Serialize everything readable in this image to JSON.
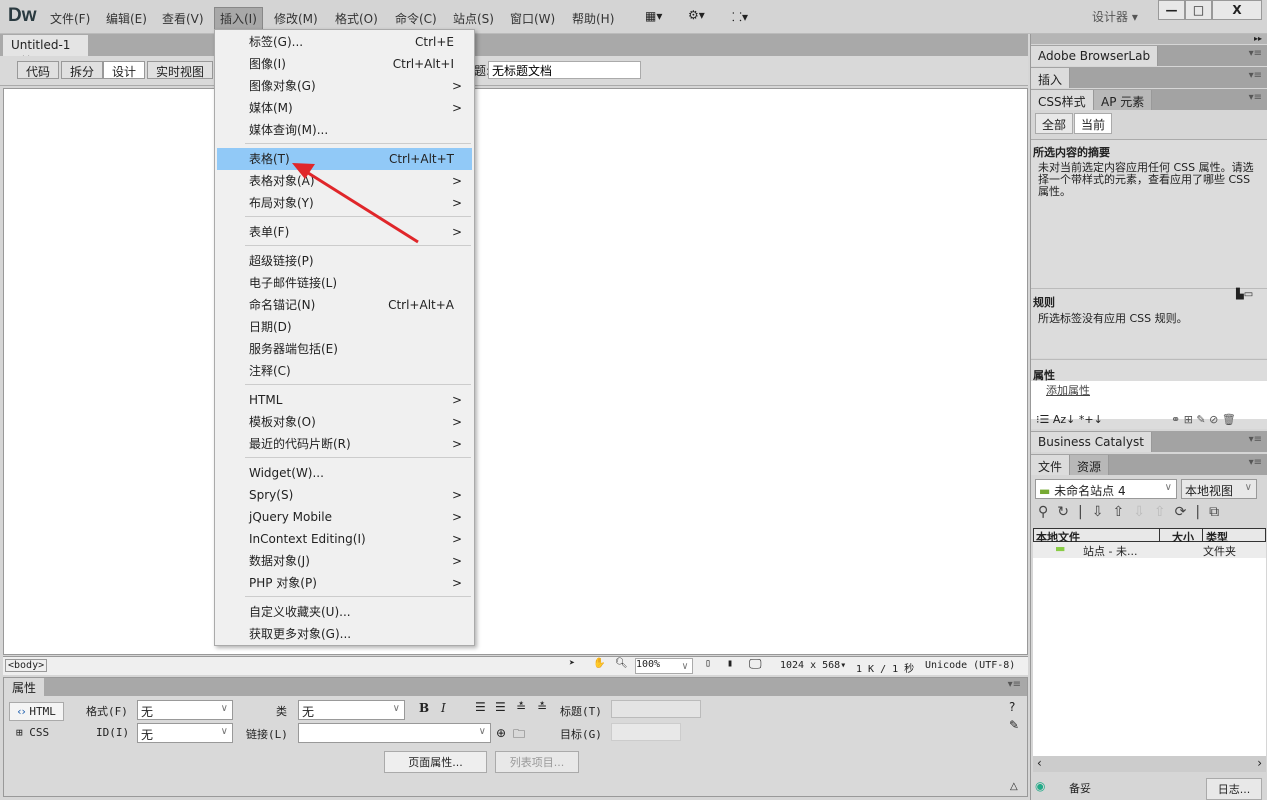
{
  "app": {
    "logo": "Dw",
    "menus": [
      "文件(F)",
      "编辑(E)",
      "查看(V)",
      "插入(I)",
      "修改(M)",
      "格式(O)",
      "命令(C)",
      "站点(S)",
      "窗口(W)",
      "帮助(H)"
    ],
    "workspace": "设计器",
    "minimize": "—",
    "maximize": "□",
    "close": "X"
  },
  "document": {
    "tab": "Untitled-1",
    "tab_close": "×",
    "views": [
      "代码",
      "拆分",
      "设计",
      "实时视图"
    ],
    "title_label": "题:",
    "title_value": "无标题文档"
  },
  "insert_menu": {
    "items": [
      {
        "label": "标签(G)...",
        "shortcut": "Ctrl+E"
      },
      {
        "label": "图像(I)",
        "shortcut": "Ctrl+Alt+I"
      },
      {
        "label": "图像对象(G)",
        "submenu": true
      },
      {
        "label": "媒体(M)",
        "submenu": true
      },
      {
        "label": "媒体查询(M)..."
      },
      {
        "sep": true
      },
      {
        "label": "表格(T)",
        "shortcut": "Ctrl+Alt+T",
        "highlighted": true
      },
      {
        "label": "表格对象(A)",
        "submenu": true
      },
      {
        "label": "布局对象(Y)",
        "submenu": true
      },
      {
        "sep": true
      },
      {
        "label": "表单(F)",
        "submenu": true
      },
      {
        "sep": true
      },
      {
        "label": "超级链接(P)"
      },
      {
        "label": "电子邮件链接(L)"
      },
      {
        "label": "命名锚记(N)",
        "shortcut": "Ctrl+Alt+A"
      },
      {
        "label": "日期(D)"
      },
      {
        "label": "服务器端包括(E)"
      },
      {
        "label": "注释(C)"
      },
      {
        "sep": true
      },
      {
        "label": "HTML",
        "submenu": true
      },
      {
        "label": "模板对象(O)",
        "submenu": true
      },
      {
        "label": "最近的代码片断(R)",
        "submenu": true
      },
      {
        "sep": true
      },
      {
        "label": "Widget(W)..."
      },
      {
        "label": "Spry(S)",
        "submenu": true
      },
      {
        "label": "jQuery Mobile",
        "submenu": true
      },
      {
        "label": "InContext Editing(I)",
        "submenu": true
      },
      {
        "label": "数据对象(J)",
        "submenu": true
      },
      {
        "label": "PHP 对象(P)",
        "submenu": true
      },
      {
        "sep": true
      },
      {
        "label": "自定义收藏夹(U)..."
      },
      {
        "label": "获取更多对象(G)..."
      }
    ],
    "submenu_arrow": ">",
    "highlight_color": "#91c9f7",
    "annotation_arrow_color": "#e0262a"
  },
  "status": {
    "tag": "<body>",
    "zoom": "100%",
    "size": "1024 x 568",
    "download": "1 K / 1 秒",
    "encoding": "Unicode (UTF-8)"
  },
  "properties": {
    "title": "属性",
    "html_btn": "HTML",
    "css_btn": "CSS",
    "format_label": "格式(F)",
    "format_value": "无",
    "id_label": "ID(I)",
    "id_value": "无",
    "class_label": "类",
    "class_value": "无",
    "link_label": "链接(L)",
    "title_label": "标题(T)",
    "target_label": "目标(G)",
    "bold": "B",
    "italic": "I",
    "page_props": "页面属性...",
    "list_item": "列表项目..."
  },
  "right_panel": {
    "browserlab": "Adobe BrowserLab",
    "insert": "插入",
    "css_tab": "CSS样式",
    "ap_tab": "AP 元素",
    "all": "全部",
    "current": "当前",
    "summary_title": "所选内容的摘要",
    "summary_text": "未对当前选定内容应用任何 CSS 属性。请选择一个带样式的元素，查看应用了哪些 CSS 属性。",
    "rules_title": "规则",
    "rules_text": "所选标签没有应用 CSS 规则。",
    "props_title": "属性",
    "add_prop": "添加属性",
    "bc": "Business Catalyst",
    "files_tab": "文件",
    "assets_tab": "资源",
    "site": "未命名站点 4",
    "view": "本地视图",
    "col_local": "本地文件",
    "col_size": "大小",
    "col_type": "类型",
    "row_name": "站点 - 未...",
    "row_type": "文件夹",
    "backup": "备妥",
    "log": "日志..."
  }
}
